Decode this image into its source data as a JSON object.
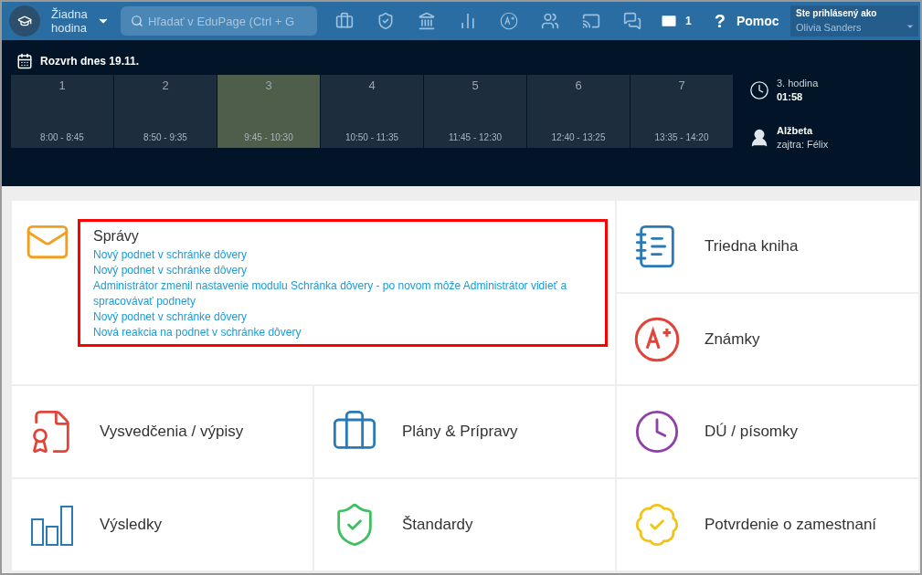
{
  "topbar": {
    "lesson_label": "Žiadna hodina",
    "search": {
      "placeholder": "Hľadať v EduPage (Ctrl + G"
    },
    "mail_count": "1",
    "help_icon": "?",
    "help": "Pomoc",
    "login": {
      "label": "Ste prihlásený ako",
      "user": "Olivia Sanders"
    }
  },
  "schedule": {
    "title": "Rozvrh dnes 19.11.",
    "slots": [
      {
        "number": "1",
        "time": "8:00 - 8:45",
        "selected": false
      },
      {
        "number": "2",
        "time": "8:50 - 9:35",
        "selected": false
      },
      {
        "number": "3",
        "time": "9:45 - 10:30",
        "selected": true
      },
      {
        "number": "4",
        "time": "10:50 - 11:35",
        "selected": false
      },
      {
        "number": "5",
        "time": "11:45 - 12:30",
        "selected": false
      },
      {
        "number": "6",
        "time": "12:40 - 13:25",
        "selected": false
      },
      {
        "number": "7",
        "time": "13:35 - 14:20",
        "selected": false
      }
    ],
    "current": {
      "lesson": "3. hodina",
      "remaining": "01:58"
    },
    "duty": {
      "name": "Alžbeta",
      "tomorrow": "zajtra: Félix"
    }
  },
  "messages": {
    "title": "Správy",
    "highlighted": true,
    "items": [
      "Nový podnet v schránke dôvery",
      "Nový podnet v schránke dôvery",
      "Administrátor zmenil nastavenie modulu Schránka dôvery - po novom môže Administrátor vidieť a spracovávať podnety",
      "Nový podnet v schránke dôvery",
      "Nová reakcia na podnet v schránke dôvery"
    ]
  },
  "tiles": [
    {
      "kind": "book",
      "label": "Triedna kniha"
    },
    {
      "kind": "grades",
      "label": "Známky"
    },
    {
      "kind": "certificate",
      "label": "Vysvedčenia / výpisy"
    },
    {
      "kind": "briefcase",
      "label": "Plány & Prípravy"
    },
    {
      "kind": "clock",
      "label": "DÚ / písomky"
    },
    {
      "kind": "chart",
      "label": "Výsledky"
    },
    {
      "kind": "shield",
      "label": "Štandardy"
    },
    {
      "kind": "badge",
      "label": "Potvrdenie o zamestnaní"
    }
  ]
}
